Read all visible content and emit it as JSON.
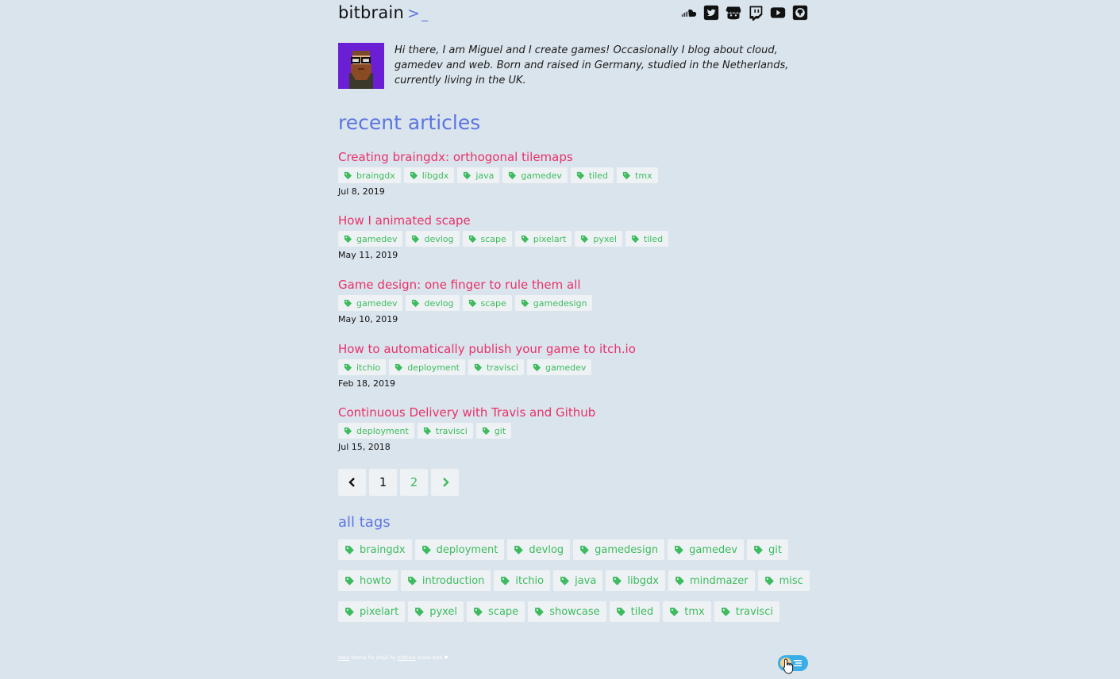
{
  "header": {
    "brand": "bitbrain",
    "prompt_symbol": ">",
    "cursor_symbol": "_",
    "social": [
      {
        "name": "soundcloud-icon"
      },
      {
        "name": "twitter-icon"
      },
      {
        "name": "itchio-icon"
      },
      {
        "name": "twitch-icon"
      },
      {
        "name": "youtube-icon"
      },
      {
        "name": "github-icon"
      }
    ]
  },
  "intro": {
    "text": "Hi there, I am Miguel and I create games! Occasionally I blog about cloud, gamedev and web. Born and raised in Germany, studied in the Netherlands, currently living in the UK."
  },
  "recent": {
    "heading": "recent articles",
    "articles": [
      {
        "title": "Creating braingdx: orthogonal tilemaps",
        "tags": [
          "braingdx",
          "libgdx",
          "java",
          "gamedev",
          "tiled",
          "tmx"
        ],
        "date": "Jul 8, 2019"
      },
      {
        "title": "How I animated scape",
        "tags": [
          "gamedev",
          "devlog",
          "scape",
          "pixelart",
          "pyxel",
          "tiled"
        ],
        "date": "May 11, 2019"
      },
      {
        "title": "Game design: one finger to rule them all",
        "tags": [
          "gamedev",
          "devlog",
          "scape",
          "gamedesign"
        ],
        "date": "May 10, 2019"
      },
      {
        "title": "How to automatically publish your game to itch.io",
        "tags": [
          "itchio",
          "deployment",
          "travisci",
          "gamedev"
        ],
        "date": "Feb 18, 2019"
      },
      {
        "title": "Continuous Delivery with Travis and Github",
        "tags": [
          "deployment",
          "travisci",
          "git"
        ],
        "date": "Jul 15, 2018"
      }
    ]
  },
  "pagination": {
    "current": "1",
    "next_page": "2"
  },
  "alltags": {
    "heading": "all tags",
    "rows": [
      [
        "braingdx",
        "deployment",
        "devlog",
        "gamedesign",
        "gamedev",
        "git"
      ],
      [
        "howto",
        "introduction",
        "itchio",
        "java",
        "libgdx",
        "mindmazer",
        "misc"
      ],
      [
        "pixelart",
        "pyxel",
        "scape",
        "showcase",
        "tiled",
        "tmx",
        "travisci"
      ]
    ]
  },
  "footer": {
    "theme_link": "dash",
    "text1": "theme for Jekyll by",
    "author_link": "bitbrain",
    "text2": "made with"
  },
  "colors": {
    "background": "#dae4ec",
    "accent": "#5c76e0",
    "article_link": "#e8316a",
    "tag": "#3dbb5e"
  }
}
